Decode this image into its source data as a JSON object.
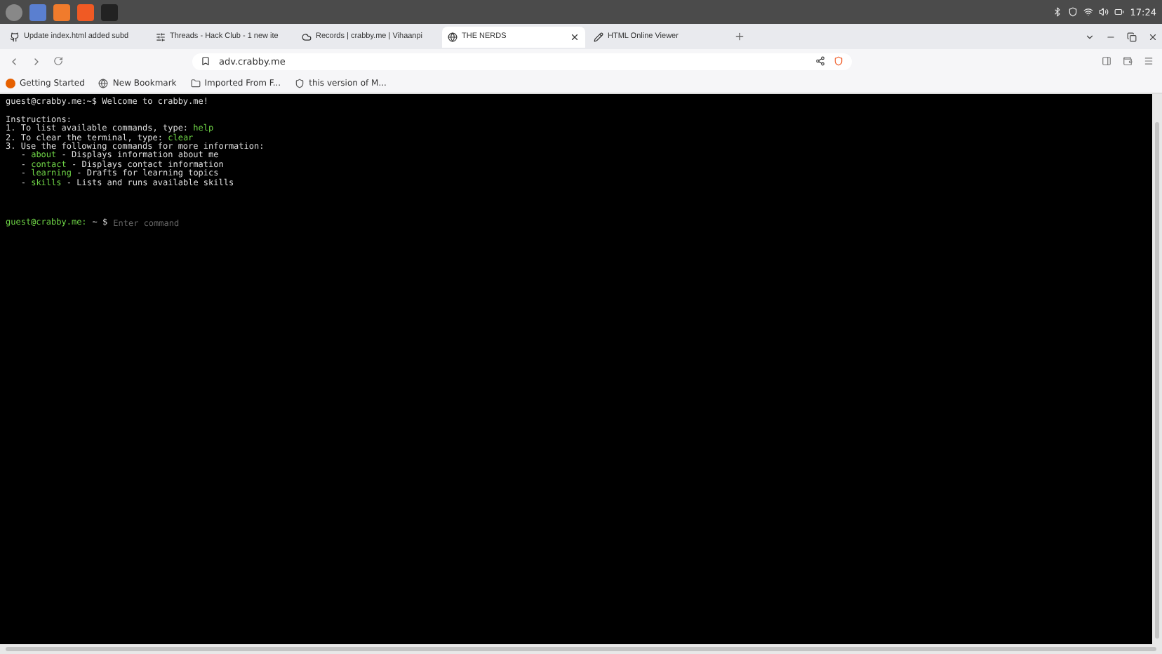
{
  "taskbar": {
    "clock": "17:24"
  },
  "tabs": [
    {
      "title": "Update index.html added subd",
      "selected": false
    },
    {
      "title": "Threads - Hack Club - 1 new ite",
      "selected": false
    },
    {
      "title": "Records | crabby.me | Vihaanpi",
      "selected": false
    },
    {
      "title": "THE NERDS",
      "selected": true
    },
    {
      "title": "HTML Online Viewer",
      "selected": false
    }
  ],
  "address": {
    "url": "adv.crabby.me"
  },
  "bookmarks": [
    {
      "label": "Getting Started"
    },
    {
      "label": "New Bookmark"
    },
    {
      "label": "Imported From F..."
    },
    {
      "label": "this version of M..."
    }
  ],
  "terminal": {
    "lines": [
      {
        "kind": "prompt",
        "prompt": "guest@crabby.me:~$",
        "text": "Welcome to crabby.me!"
      },
      {
        "kind": "blank"
      },
      {
        "kind": "text",
        "text": "Instructions:"
      },
      {
        "kind": "instruction",
        "text": "1. To list available commands, type:",
        "command": "help"
      },
      {
        "kind": "instruction",
        "text": "2. To clear the terminal, type:",
        "command": "clear"
      },
      {
        "kind": "text",
        "text": "3. Use the following commands for more information:"
      },
      {
        "kind": "item",
        "bullet": "-",
        "command": "about",
        "description": "- Displays information about me"
      },
      {
        "kind": "item",
        "bullet": "-",
        "command": "contact",
        "description": "- Displays contact information"
      },
      {
        "kind": "item",
        "bullet": "-",
        "command": "learning",
        "description": "- Drafts for learning topics"
      },
      {
        "kind": "item",
        "bullet": "-",
        "command": "skills",
        "description": "- Lists and runs available skills"
      }
    ],
    "input": {
      "prompt": "guest@crabby.me:",
      "path": "~ $",
      "placeholder": "Enter command"
    }
  }
}
